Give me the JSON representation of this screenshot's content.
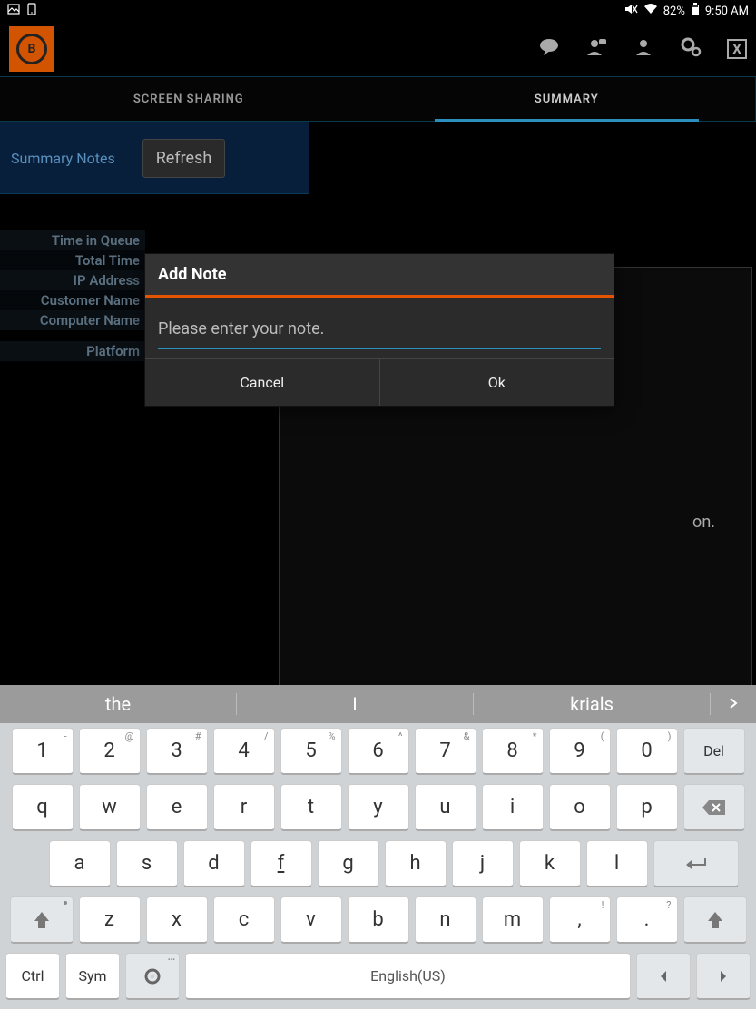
{
  "status": {
    "mute_icon": "mute-icon",
    "wifi_icon": "wifi-icon",
    "battery_pct": "82%",
    "battery_icon": "battery-icon",
    "time": "9:50 AM"
  },
  "header": {
    "chat_icon": "chat-icon",
    "person_badge_icon": "person-badge-icon",
    "person_icon": "person-icon",
    "gear_icon": "gear-icon",
    "close_label": "X"
  },
  "tabs": {
    "screen_sharing": "SCREEN SHARING",
    "summary": "SUMMARY"
  },
  "notes_bar": {
    "label": "Summary Notes",
    "refresh": "Refresh"
  },
  "details": {
    "time_in_queue": "Time in Queue",
    "total_time": "Total Time",
    "ip_address": "IP Address",
    "customer_name": "Customer Name",
    "computer_name": "Computer Name",
    "platform": "Platform"
  },
  "right_panel": {
    "partial_text": "on.",
    "add_note": "Add Note"
  },
  "modal": {
    "title": "Add Note",
    "placeholder": "Please enter your note.",
    "cancel": "Cancel",
    "ok": "Ok"
  },
  "keyboard": {
    "suggestions": [
      "the",
      "I",
      "krials"
    ],
    "row1": [
      {
        "main": "1",
        "super": "-"
      },
      {
        "main": "2",
        "super": "@"
      },
      {
        "main": "3",
        "super": "#"
      },
      {
        "main": "4",
        "super": "/"
      },
      {
        "main": "5",
        "super": "%"
      },
      {
        "main": "6",
        "super": "^"
      },
      {
        "main": "7",
        "super": "&"
      },
      {
        "main": "8",
        "super": "*"
      },
      {
        "main": "9",
        "super": "("
      },
      {
        "main": "0",
        "super": ")"
      }
    ],
    "del": "Del",
    "row2": [
      "q",
      "w",
      "e",
      "r",
      "t",
      "y",
      "u",
      "i",
      "o",
      "p"
    ],
    "row3": [
      "a",
      "s",
      "d",
      "f",
      "g",
      "h",
      "j",
      "k",
      "l"
    ],
    "row4": [
      "z",
      "x",
      "c",
      "v",
      "b",
      "n",
      "m"
    ],
    "comma_super": "!",
    "period_super": "?",
    "ctrl": "Ctrl",
    "sym": "Sym",
    "space": "English(US)"
  }
}
